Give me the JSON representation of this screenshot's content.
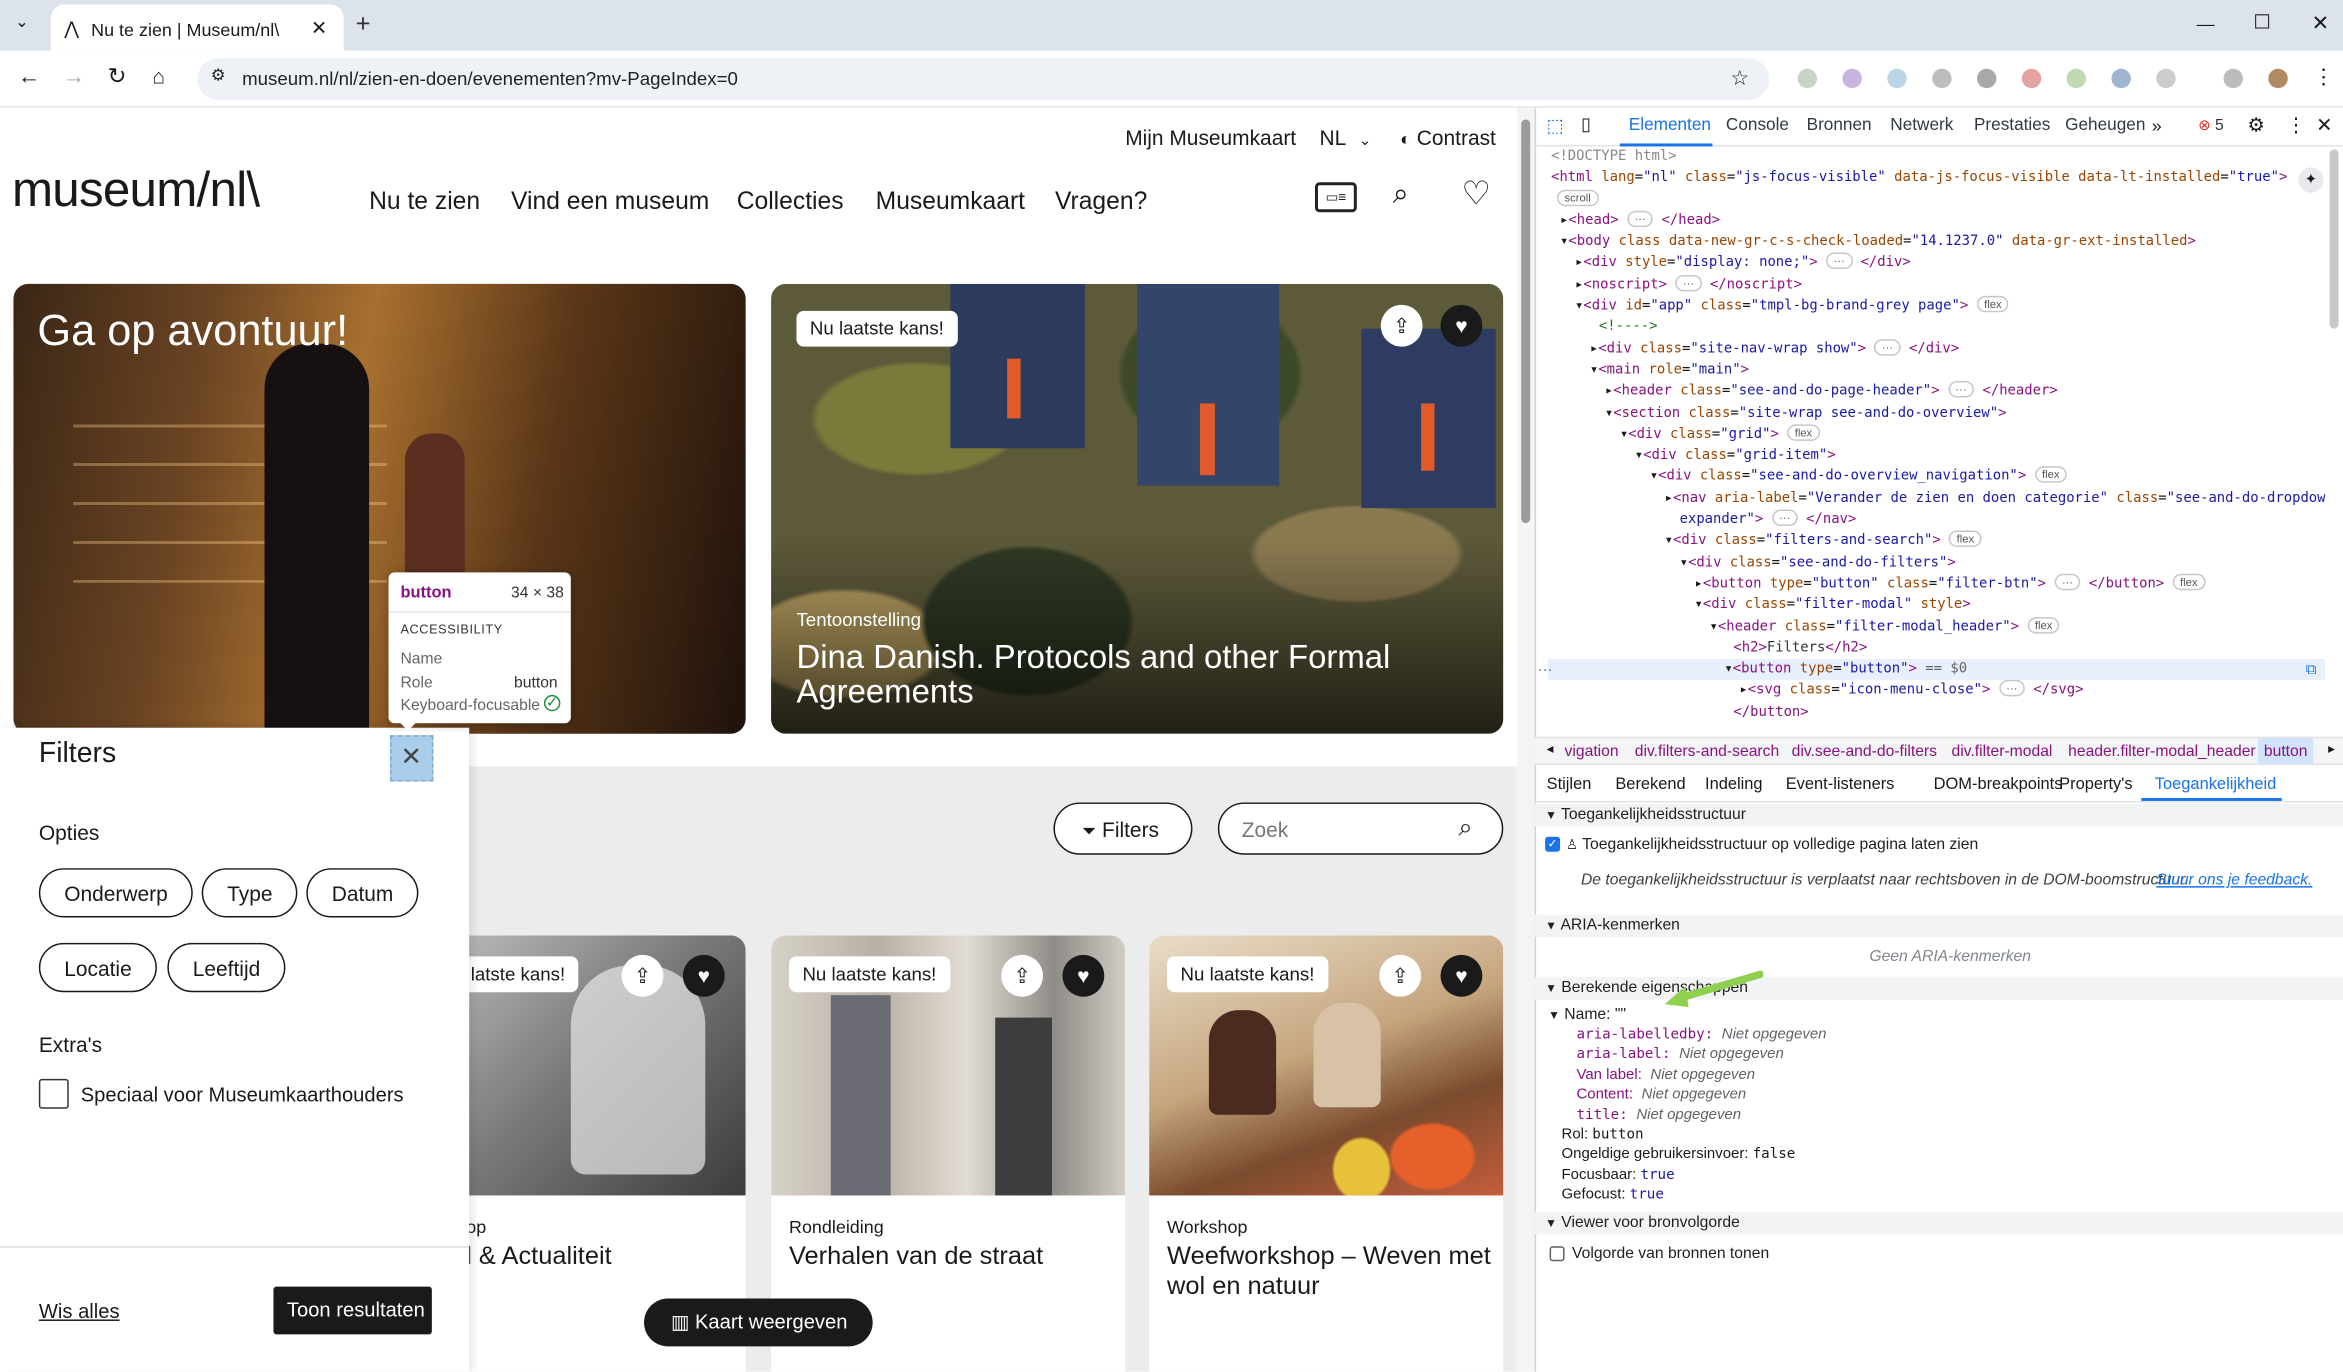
{
  "browser": {
    "tab_title": "Nu te zien | Museum/nl\\",
    "url": "museum.nl/nl/zien-en-doen/evenementen?mv-PageIndex=0",
    "tab_favicon": "museum-favicon",
    "new_tab": "+"
  },
  "site": {
    "logo": "museum/nl\\",
    "utility": {
      "account": "Mijn Museumkaart",
      "language": "NL",
      "contrast": "Contrast"
    },
    "nav": [
      "Nu te zien",
      "Vind een museum",
      "Collecties",
      "Museumkaart",
      "Vragen?"
    ],
    "hero_left": {
      "title": "Ga op avontuur!"
    },
    "hero_right": {
      "badge": "Nu laatste kans!",
      "type": "Tentoonstelling",
      "title": "Dina Danish. Protocols and other Formal Agreements"
    },
    "toolbar": {
      "filters": "Filters",
      "search_placeholder": "Zoek"
    },
    "cards": [
      {
        "badge": "latste kans!",
        "type": "op",
        "title": "l & Actualiteit"
      },
      {
        "badge": "Nu laatste kans!",
        "type": "Rondleiding",
        "title": "Verhalen van de straat"
      },
      {
        "badge": "Nu laatste kans!",
        "type": "Workshop",
        "title": "Weefworkshop – Weven met wol en natuur"
      }
    ],
    "map_button": "Kaart weergeven"
  },
  "filters": {
    "title": "Filters",
    "options_heading": "Opties",
    "chips": [
      "Onderwerp",
      "Type",
      "Datum",
      "Locatie",
      "Leeftijd"
    ],
    "extras_heading": "Extra's",
    "extra_checkbox": "Speciaal voor Museumkaarthouders",
    "clear": "Wis alles",
    "show": "Toon resultaten"
  },
  "tooltip": {
    "element": "button",
    "size": "34 × 38",
    "heading": "ACCESSIBILITY",
    "name_label": "Name",
    "role_label": "Role",
    "role_value": "button",
    "focus_label": "Keyboard-focusable"
  },
  "devtools": {
    "tabs": [
      "Elementen",
      "Console",
      "Bronnen",
      "Netwerk",
      "Prestaties",
      "Geheugen"
    ],
    "error_count": "5",
    "breadcrumbs": [
      "vigation",
      "div.filters-and-search",
      "div.see-and-do-filters",
      "div.filter-modal",
      "header.filter-modal_header",
      "button"
    ],
    "subtabs": [
      "Stijlen",
      "Berekend",
      "Indeling",
      "Event-listeners",
      "DOM-breakpoints",
      "Property's",
      "Toegankelijkheid"
    ],
    "acc": {
      "tree_heading": "Toegankelijkheidsstructuur",
      "tree_checkbox": "Toegankelijkheidsstructuur op volledige pagina laten zien",
      "tree_note": "De toegankelijkheidsstructuur is verplaatst naar rechtsboven in de DOM-boomstructuur.",
      "tree_link": "Stuur ons je feedback.",
      "aria_heading": "ARIA-kenmerken",
      "aria_empty": "Geen ARIA-kenmerken",
      "computed_heading": "Berekende eigenschappen",
      "name_row": "Name: \"\"",
      "name_items": [
        {
          "k": "aria-labelledby:",
          "v": "Niet opgegeven"
        },
        {
          "k": "aria-label:",
          "v": "Niet opgegeven"
        },
        {
          "k": "Van label:",
          "v": "Niet opgegeven"
        },
        {
          "k": "Content:",
          "v": "Niet opgegeven"
        },
        {
          "k": "title:",
          "v": "Niet opgegeven"
        }
      ],
      "props": [
        {
          "k": "Rol:",
          "v": "button"
        },
        {
          "k": "Ongeldige gebruikersinvoer:",
          "v": "false"
        },
        {
          "k": "Focusbaar:",
          "v": "true"
        },
        {
          "k": "Gefocust:",
          "v": "true"
        }
      ],
      "source_heading": "Viewer voor bronvolgorde",
      "source_checkbox": "Volgorde van bronnen tonen"
    }
  }
}
